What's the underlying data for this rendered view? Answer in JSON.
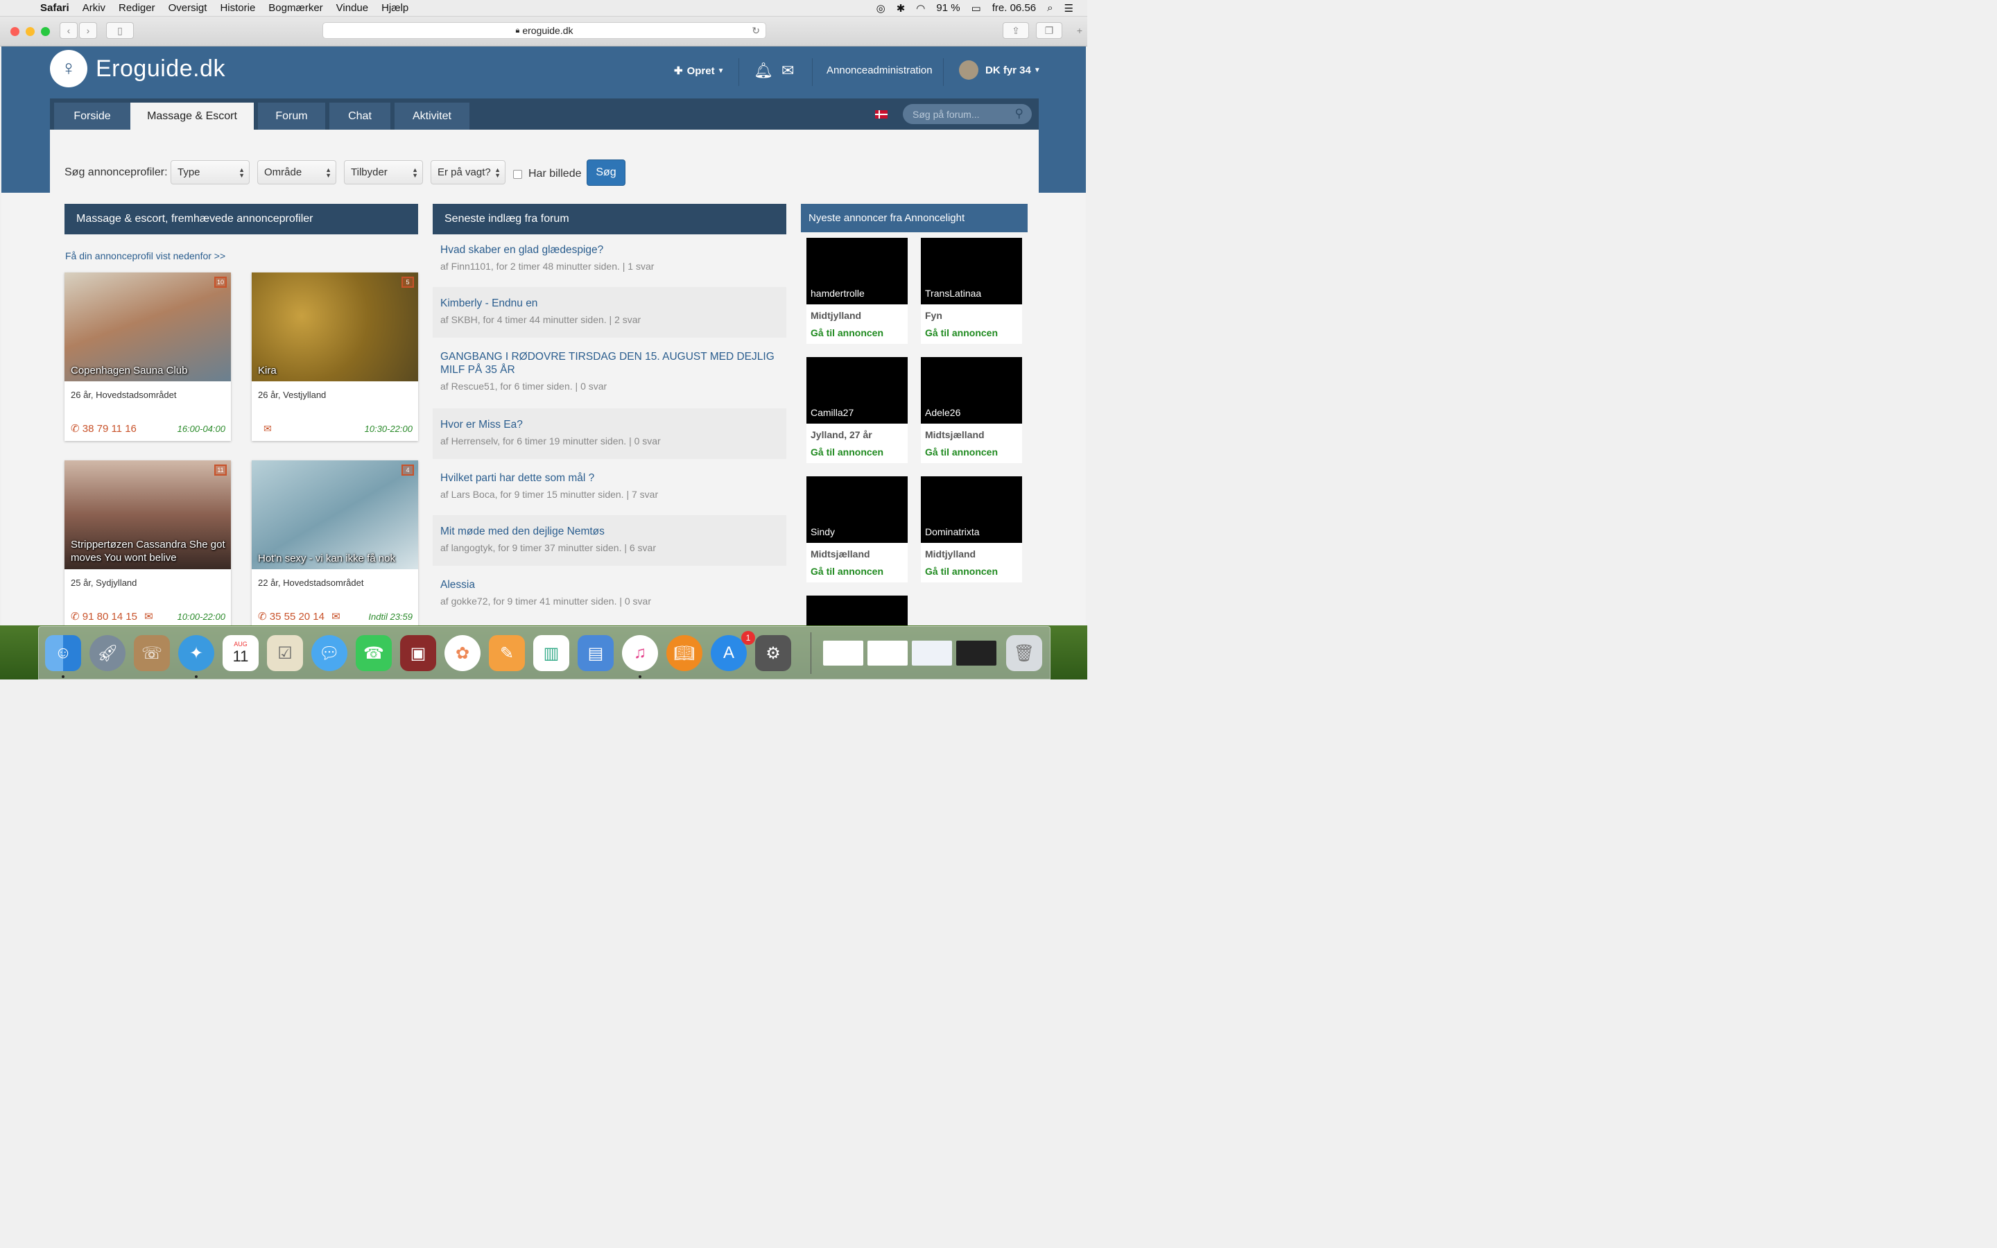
{
  "menubar": {
    "app": "Safari",
    "items": [
      "Arkiv",
      "Rediger",
      "Oversigt",
      "Historie",
      "Bogmærker",
      "Vindue",
      "Hjælp"
    ],
    "battery": "91 %",
    "clock": "fre. 06.56"
  },
  "browser": {
    "url": "eroguide.dk"
  },
  "header": {
    "logo_text": "Eroguide.dk",
    "opret": "Opret",
    "annonceadmin": "Annonceadministration",
    "user": "DK fyr 34"
  },
  "tabs": [
    "Forside",
    "Massage & Escort",
    "Forum",
    "Chat",
    "Aktivitet"
  ],
  "forum_search": {
    "placeholder": "Søg på forum..."
  },
  "filters": {
    "label": "Søg annonceprofiler:",
    "type": "Type",
    "omrade": "Område",
    "tilbyder": "Tilbyder",
    "vagt": "Er på vagt?",
    "har_billede": "Har billede",
    "search_button": "Søg"
  },
  "featured": {
    "heading": "Massage & escort, fremhævede annonceprofiler",
    "promo_link": "Få din annonceprofil vist nedenfor >>",
    "cards": [
      {
        "caption": "Copenhagen Sauna Club",
        "badge": "10",
        "age": "26 år, Hovedstadsområdet",
        "phone": "38 79 11 16",
        "hours": "16:00-04:00",
        "color": "#b08060"
      },
      {
        "caption": "Kira",
        "badge": "5",
        "age": "26 år, Vestjylland",
        "phone": "",
        "hours": "10:30-22:00",
        "color": "#9a7a2a"
      },
      {
        "caption": "Strippertøzen Cassandra She got moves You wont belive",
        "badge": "11",
        "age": "25 år, Sydjylland",
        "phone": "91 80 14 15",
        "hours": "10:00-22:00",
        "color": "#6a4a3a"
      },
      {
        "caption": "Hot'n sexy - vi kan ikke få nok",
        "badge": "4",
        "age": "22 år, Hovedstadsområdet",
        "phone": "35 55 20 14",
        "hours": "Indtil 23:59",
        "color": "#8aa8b8"
      }
    ]
  },
  "forum": {
    "heading": "Seneste indlæg fra forum",
    "posts": [
      {
        "title": "Hvad skaber en glad glædespige?",
        "meta": "af Finn1101, for 2 timer 48 minutter siden. | 1 svar"
      },
      {
        "title": "Kimberly - Endnu en",
        "meta": "af SKBH, for 4 timer 44 minutter siden. | 2 svar"
      },
      {
        "title": "GANGBANG I RØDOVRE TIRSDAG DEN 15. AUGUST MED DEJLIG MILF PÅ 35 ÅR",
        "meta": "af Rescue51, for 6 timer siden. | 0 svar"
      },
      {
        "title": "Hvor er Miss Ea?",
        "meta": "af Herrenselv, for 6 timer 19 minutter siden. | 0 svar"
      },
      {
        "title": "Hvilket parti har dette som mål ?",
        "meta": "af Lars Boca, for 9 timer 15 minutter siden. | 7 svar"
      },
      {
        "title": "Mit møde med den dejlige Nemtøs",
        "meta": "af langogtyk, for 9 timer 37 minutter siden. | 6 svar"
      },
      {
        "title": "Alessia",
        "meta": "af gokke72, for 9 timer 41 minutter siden. | 0 svar"
      }
    ]
  },
  "annoncelight": {
    "heading": "Nyeste annoncer fra Annoncelight",
    "go_label": "Gå til annoncen",
    "ads": [
      {
        "name": "hamdertrolle",
        "region": "Midtjylland"
      },
      {
        "name": "TransLatinaa",
        "region": "Fyn"
      },
      {
        "name": "Camilla27",
        "region": "Jylland, 27 år"
      },
      {
        "name": "Adele26",
        "region": "Midtsjælland"
      },
      {
        "name": "Sindy",
        "region": "Midtsjælland"
      },
      {
        "name": "Dominatrixta",
        "region": "Midtjylland"
      }
    ]
  },
  "dock": {
    "calendar_month": "AUG",
    "calendar_day": "11",
    "appstore_badge": "1"
  }
}
